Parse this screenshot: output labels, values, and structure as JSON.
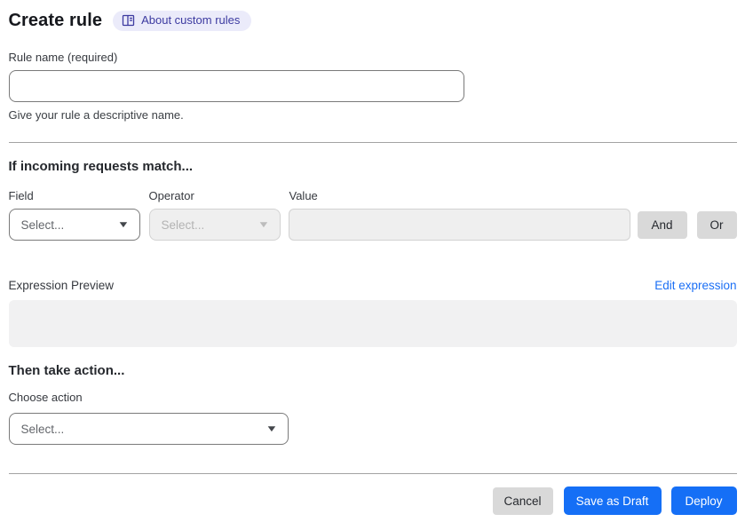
{
  "header": {
    "title": "Create rule",
    "about_link_label": "About custom rules"
  },
  "rule_name": {
    "label": "Rule name (required)",
    "value": "",
    "helper": "Give your rule a descriptive name."
  },
  "match_section": {
    "heading": "If incoming requests match...",
    "field_label": "Field",
    "operator_label": "Operator",
    "value_label": "Value",
    "field_placeholder": "Select...",
    "operator_placeholder": "Select...",
    "value_value": "",
    "and_button_label": "And",
    "or_button_label": "Or"
  },
  "expression": {
    "label": "Expression Preview",
    "edit_link_label": "Edit expression",
    "content": ""
  },
  "action_section": {
    "heading": "Then take action...",
    "choose_label": "Choose action",
    "action_placeholder": "Select..."
  },
  "footer": {
    "cancel_label": "Cancel",
    "save_draft_label": "Save as Draft",
    "deploy_label": "Deploy"
  },
  "colors": {
    "primary_blue": "#156ff6",
    "link_blue": "#1b6ff5",
    "badge_bg": "#ebebfa",
    "badge_text": "#3c3aa0",
    "gray_button_bg": "#d9d9d9",
    "disabled_bg": "#efefef",
    "preview_bg": "#f1f1f2"
  }
}
